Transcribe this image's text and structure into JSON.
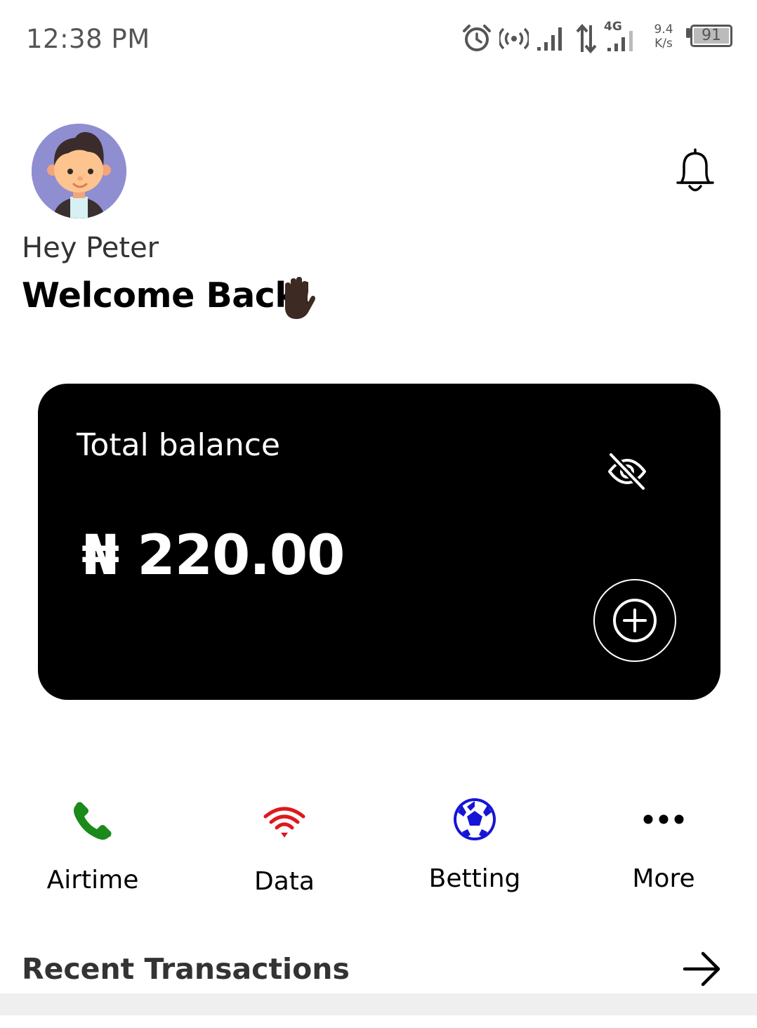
{
  "status_bar": {
    "time": "12:38 PM",
    "network_type": "4G",
    "net_speed_value": "9.4",
    "net_speed_unit": "K/s",
    "battery": "91"
  },
  "header": {
    "greeting": "Hey Peter",
    "welcome": "Welcome Back!",
    "avatar_icon": "avatar",
    "notification_icon": "bell-icon"
  },
  "balance_card": {
    "label": "Total balance",
    "amount": "₦ 220.00",
    "visibility_icon": "eye-off-icon",
    "add_icon": "plus-circle-icon"
  },
  "quick_actions": [
    {
      "label": "Airtime",
      "icon": "phone-icon",
      "color": "#1a8a1a"
    },
    {
      "label": "Data",
      "icon": "wifi-icon",
      "color": "#e0181b"
    },
    {
      "label": "Betting",
      "icon": "soccer-ball-icon",
      "color": "#1515d6"
    },
    {
      "label": "More",
      "icon": "more-icon",
      "color": "#000000"
    }
  ],
  "recent_transactions": {
    "title": "Recent Transactions",
    "arrow_icon": "arrow-right-icon"
  }
}
